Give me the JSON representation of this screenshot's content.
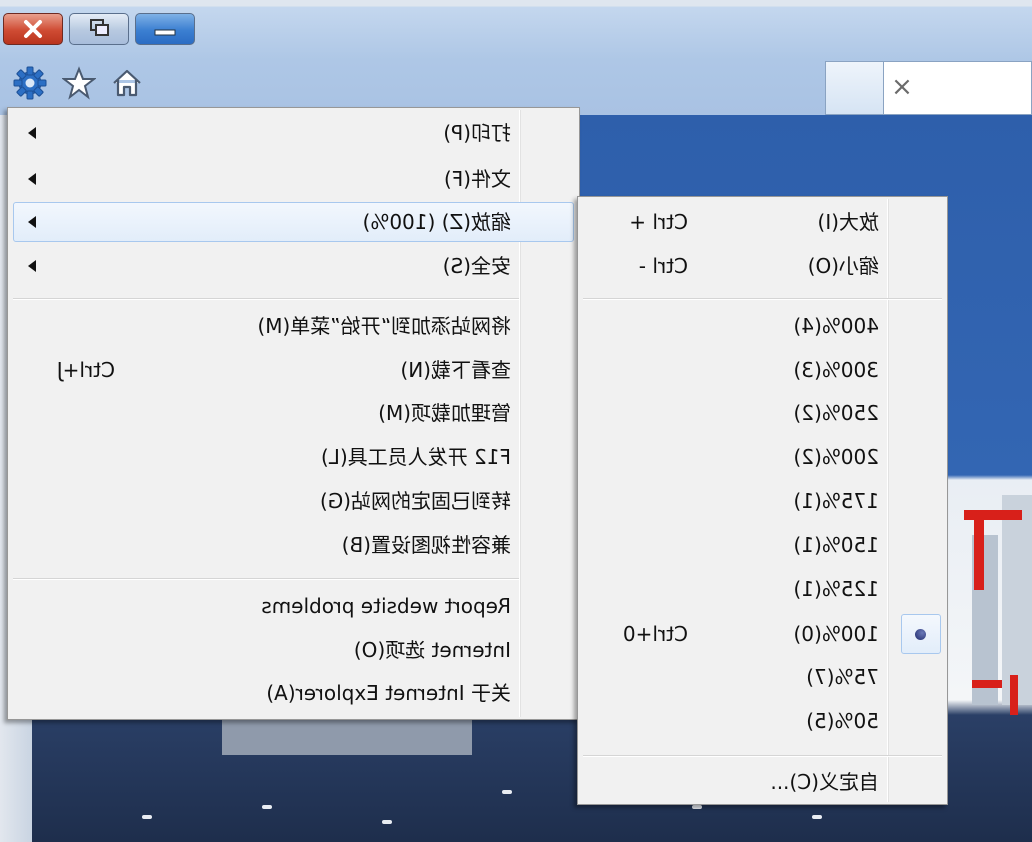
{
  "window_controls": {
    "minimize_icon": "minimize-icon",
    "restore_icon": "restore-icon",
    "close_icon": "close-icon"
  },
  "toolbar": {
    "icons": [
      "home-icon",
      "star-icon",
      "gear-icon"
    ]
  },
  "tab": {
    "close_glyph": "×"
  },
  "tools_menu": {
    "items": [
      {
        "label": "打印(P)",
        "submenu": true
      },
      {
        "label": "文件(F)",
        "submenu": true
      },
      {
        "label": "缩放(Z) (100%)",
        "submenu": true,
        "highlighted": true
      },
      {
        "label": "安全(S)",
        "submenu": true
      },
      {
        "label": "将网站添加到“开始”菜单(M)"
      },
      {
        "label": "查看下载(N)",
        "shortcut": "Ctrl+J"
      },
      {
        "label": "管理加载项(M)"
      },
      {
        "label": "F12 开发人员工具(L)"
      },
      {
        "label": "转到已固定的网站(G)"
      },
      {
        "label": "兼容性视图设置(B)"
      },
      {
        "label": "Report website problems"
      },
      {
        "label": "Internet 选项(O)"
      },
      {
        "label": "关于 Internet Explorer(A)"
      }
    ]
  },
  "zoom_menu": {
    "items": [
      {
        "label": "放大(I)",
        "shortcut": "Ctrl +"
      },
      {
        "label": "缩小(O)",
        "shortcut": "Ctrl -"
      },
      {
        "label": "400%(4)"
      },
      {
        "label": "300%(3)"
      },
      {
        "label": "250%(2)"
      },
      {
        "label": "200%(2)"
      },
      {
        "label": "175%(1)"
      },
      {
        "label": "150%(1)"
      },
      {
        "label": "125%(1)"
      },
      {
        "label": "100%(0)",
        "shortcut": "Ctrl+0",
        "selected": true
      },
      {
        "label": "75%(7)"
      },
      {
        "label": "50%(5)"
      },
      {
        "label": "自定义(C)..."
      }
    ]
  },
  "colors": {
    "menu_background": "#f1f1f1",
    "highlight_border": "#a8c8ee",
    "page_blue": "#2e5fab",
    "close_button": "#cf4b33",
    "accent_text_red": "#d8201a"
  }
}
